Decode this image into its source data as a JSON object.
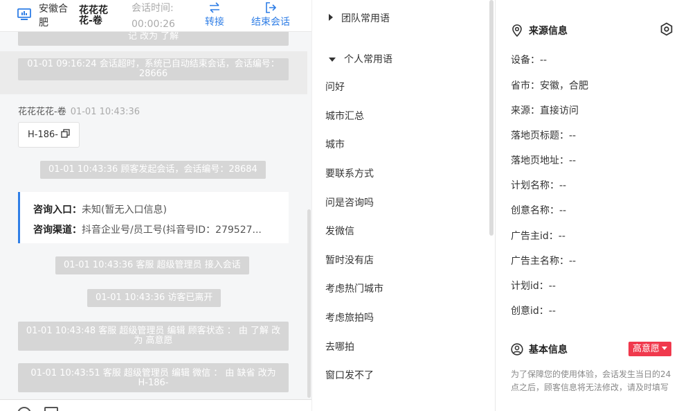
{
  "header": {
    "location": "安徽合肥",
    "visitor_name": "花花花花-卷",
    "time_label": "会话时间:",
    "time_value": "00:00:26",
    "transfer_label": "转接",
    "end_label": "结束会话"
  },
  "chat": {
    "cut_top_text": "记 改为 了解",
    "timeout_msg": "01-01 09:16:24 会话超时，系统已自动结束会话，会话编号：28666",
    "sender_name": "花花花花-卷",
    "sender_time": "01-01 10:43:36",
    "bubble_text": "H-186-",
    "start_msg": "01-01 10:43:36 顾客发起会话，会话编号：28684",
    "info_entry_label": "咨询入口：",
    "info_entry_value": "未知(暂无入口信息)",
    "info_channel_label": "咨询渠道：",
    "info_channel_value": "抖音企业号/员工号(抖音号ID：279527...",
    "join_msg": "01-01 10:43:36 客服 超级管理员 接入会话",
    "left_msg": "01-01 10:43:36 访客已离开",
    "edit_status_msg": "01-01 10:43:48 客服 超级管理员 编辑 顾客状态 ： 由 了解 改为 高意愿",
    "edit_wechat_msg": "01-01 10:43:51 客服 超级管理员 编辑 微信 ： 由 缺省 改为 H-186-"
  },
  "phrases": {
    "team_group": "团队常用语",
    "personal_group": "个人常用语",
    "items": [
      "问好",
      "城市汇总",
      "城市",
      "要联系方式",
      "问是咨询吗",
      "发微信",
      "暂时没有店",
      "考虑热门城市",
      "考虑旅拍吗",
      "去哪拍",
      "窗口发不了"
    ]
  },
  "source_info": {
    "title": "来源信息",
    "fields": [
      "设备：--",
      "省市：安徽，合肥",
      "来源：直接访问",
      "落地页标题：--",
      "落地页地址：--",
      "计划名称：--",
      "创意名称：--",
      "广告主id：--",
      "广告主名称：--",
      "计划id：--",
      "创意id：--"
    ]
  },
  "basic_info": {
    "title": "基本信息",
    "badge": "高意愿",
    "note": "为了保障您的使用体验，会话发生当日的24点之后，顾客信息将无法修改，请及时填写"
  },
  "colors": {
    "accent": "#2f7ee6",
    "badge": "#f0394d",
    "system_msg_bg": "#d6d6d6"
  }
}
